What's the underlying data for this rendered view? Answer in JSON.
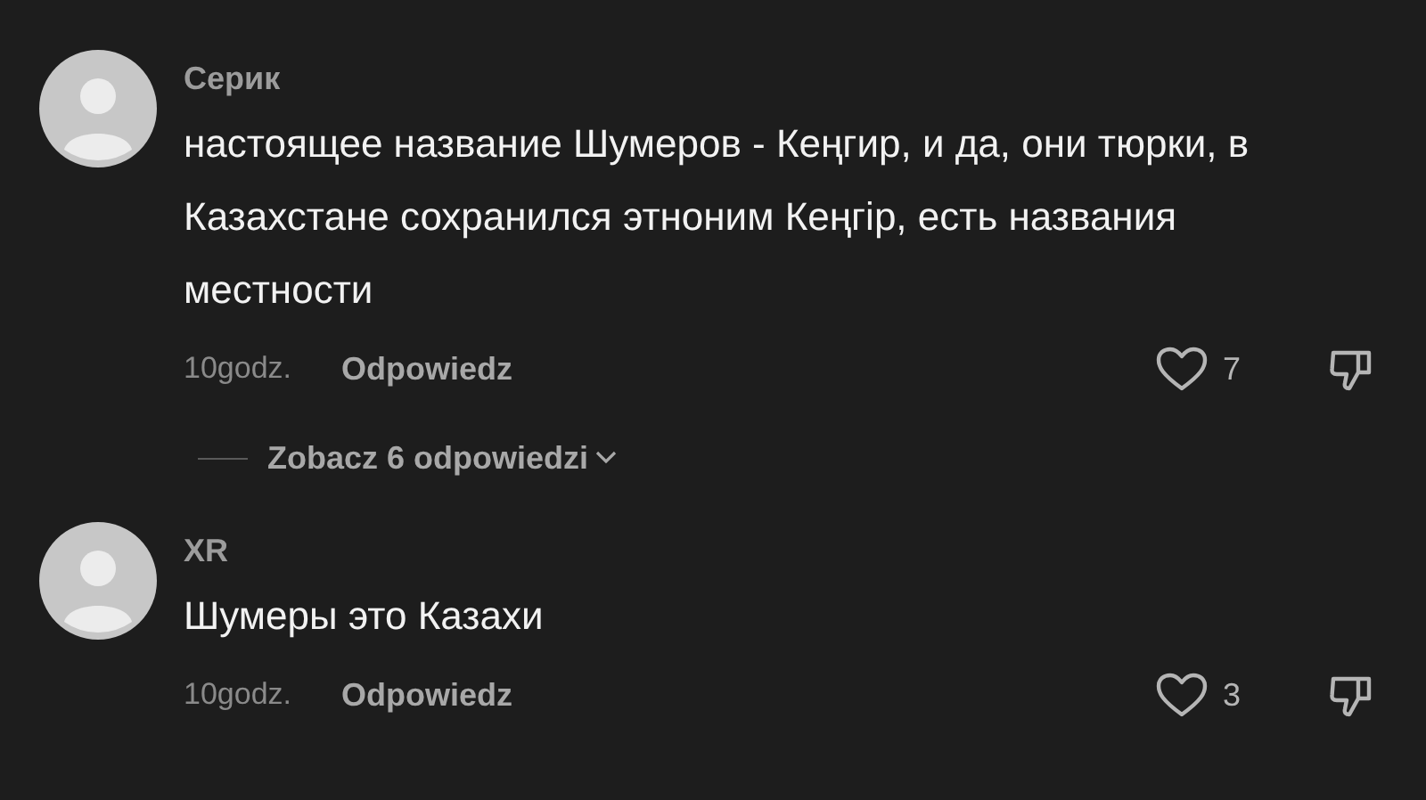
{
  "comments": [
    {
      "author": "Серик",
      "text": "настоящее название Шумеров - Кеңгир, и да, они тюрки, в Казахстане сохранился этноним Кеңгір, есть названия местности",
      "time": "10godz.",
      "reply": "Odpowiedz",
      "likes": "7",
      "liked": false,
      "replies_toggle": "Zobacz 6 odpowiedzi"
    },
    {
      "author": "XR",
      "text": "Шумеры это Казахи",
      "time": "10godz.",
      "reply": "Odpowiedz",
      "likes": "3",
      "liked": false
    }
  ]
}
